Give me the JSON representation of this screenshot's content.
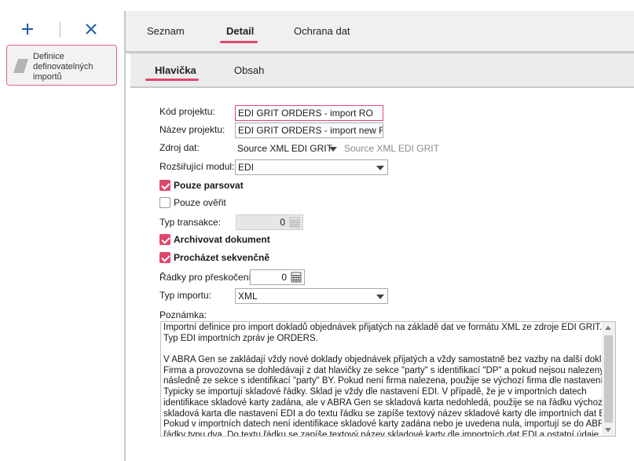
{
  "toolbar": {
    "add_icon": "plus-icon",
    "close_icon": "close-icon"
  },
  "sidebar": {
    "items": [
      {
        "label": "Definice definovatelných importů",
        "icon": "parallelogram-icon"
      }
    ]
  },
  "tabs": [
    {
      "label": "Seznam",
      "active": false
    },
    {
      "label": "Detail",
      "active": true
    },
    {
      "label": "Ochrana dat",
      "active": false
    }
  ],
  "subtabs": [
    {
      "label": "Hlavička",
      "active": true
    },
    {
      "label": "Obsah",
      "active": false
    }
  ],
  "form": {
    "kod_projektu": {
      "label": "Kód projektu:",
      "value": "EDI GRIT ORDERS - import RO"
    },
    "nazev_projektu": {
      "label": "Název projektu:",
      "value": "EDI GRIT ORDERS - import new Receiv"
    },
    "zdroj_dat": {
      "label": "Zdroj dat:",
      "value": "Source XML EDI GRIT",
      "hint": "Source XML EDI GRIT"
    },
    "rozsirujici_modul": {
      "label": "Rozšiřující modul:",
      "value": "EDI"
    },
    "pouze_parsovat": {
      "label": "Pouze parsovat",
      "checked": true
    },
    "pouze_overit": {
      "label": "Pouze ověřit",
      "checked": false
    },
    "typ_transakce": {
      "label": "Typ transakce:",
      "value": "0"
    },
    "archivovat_dokument": {
      "label": "Archivovat dokument",
      "checked": true
    },
    "prochazet_sekvencne": {
      "label": "Procházet sekvenčně",
      "checked": true
    },
    "radky_pro_preskoceni": {
      "label": "Řádky pro přeskočení:",
      "value": "0"
    },
    "typ_importu": {
      "label": "Typ importu:",
      "value": "XML"
    },
    "poznamka": {
      "label": "Poznámka:",
      "lines": [
        "Importní definice pro import dokladů objednávek přijatých na základě dat ve formátu XML ze zdroje EDI GRIT.",
        "Typ EDI importních zpráv je ORDERS.",
        "",
        "V ABRA Gen se zakládají vždy nové doklady objednávek přijatých a vždy samostatně bez vazby na další doklady.",
        "Firma a provozovna se dohledávají z dat hlavičky ze sekce \"party\" s identifikací \"DP\" a pokud nejsou nalezeny, tak",
        "následně ze sekce s identifikací \"party\" BY. Pokud není firma nalezena, použije se výchozí firma dle nastavení EDI.",
        "Typicky se importují skladové řádky. Sklad je vždy dle nastavení EDI. V případě, že je v importních datech",
        "identifikace skladové karty zadána, ale v ABRA Gen se skladová karta nedohledá, použije se na řádku výchozí",
        "skladová karta dle nastavení EDI a do textu řádku se zapíše textový název skladové karty dle importních dat EDI.",
        "Pokud v importních datech není identifikace skladové karty zadána nebo je uvedena nula, importují se do ABRA Gen",
        "řádky typu dva. Do textu řádku se zapíše textový název skladové karty dle importních dat EDI  a ostatní údaje se"
      ]
    }
  },
  "colors": {
    "accent": "#e0476c",
    "panel": "#f0f0f0"
  }
}
